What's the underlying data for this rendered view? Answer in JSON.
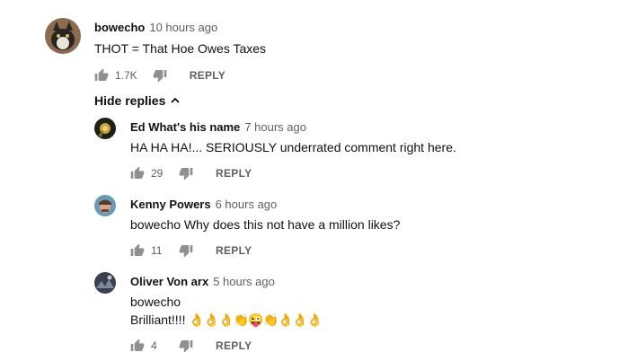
{
  "comments": [
    {
      "author": "bowecho",
      "time": "10 hours ago",
      "text": "THOT = That Hoe Owes Taxes",
      "likes": "1.7K",
      "reply_label": "REPLY"
    }
  ],
  "hide_replies_label": "Hide replies",
  "replies": [
    {
      "author": "Ed What's his name",
      "time": "7 hours ago",
      "text": "HA HA HA!... SERIOUSLY underrated comment right here.",
      "likes": "29",
      "reply_label": "REPLY"
    },
    {
      "author": "Kenny Powers",
      "time": "6 hours ago",
      "text": "bowecho Why does this not have a million likes?",
      "likes": "11",
      "reply_label": "REPLY"
    },
    {
      "author": "Oliver Von arx",
      "time": "5 hours ago",
      "text_line1": "bowecho",
      "text_line2": "Brilliant!!!!",
      "emojis": "👌👌👌👏😜👏👌👌👌",
      "likes": "4",
      "reply_label": "REPLY"
    }
  ],
  "icons": {
    "like": "thumbs-up-icon",
    "dislike": "thumbs-down-icon",
    "chevron": "chevron-up-icon"
  }
}
